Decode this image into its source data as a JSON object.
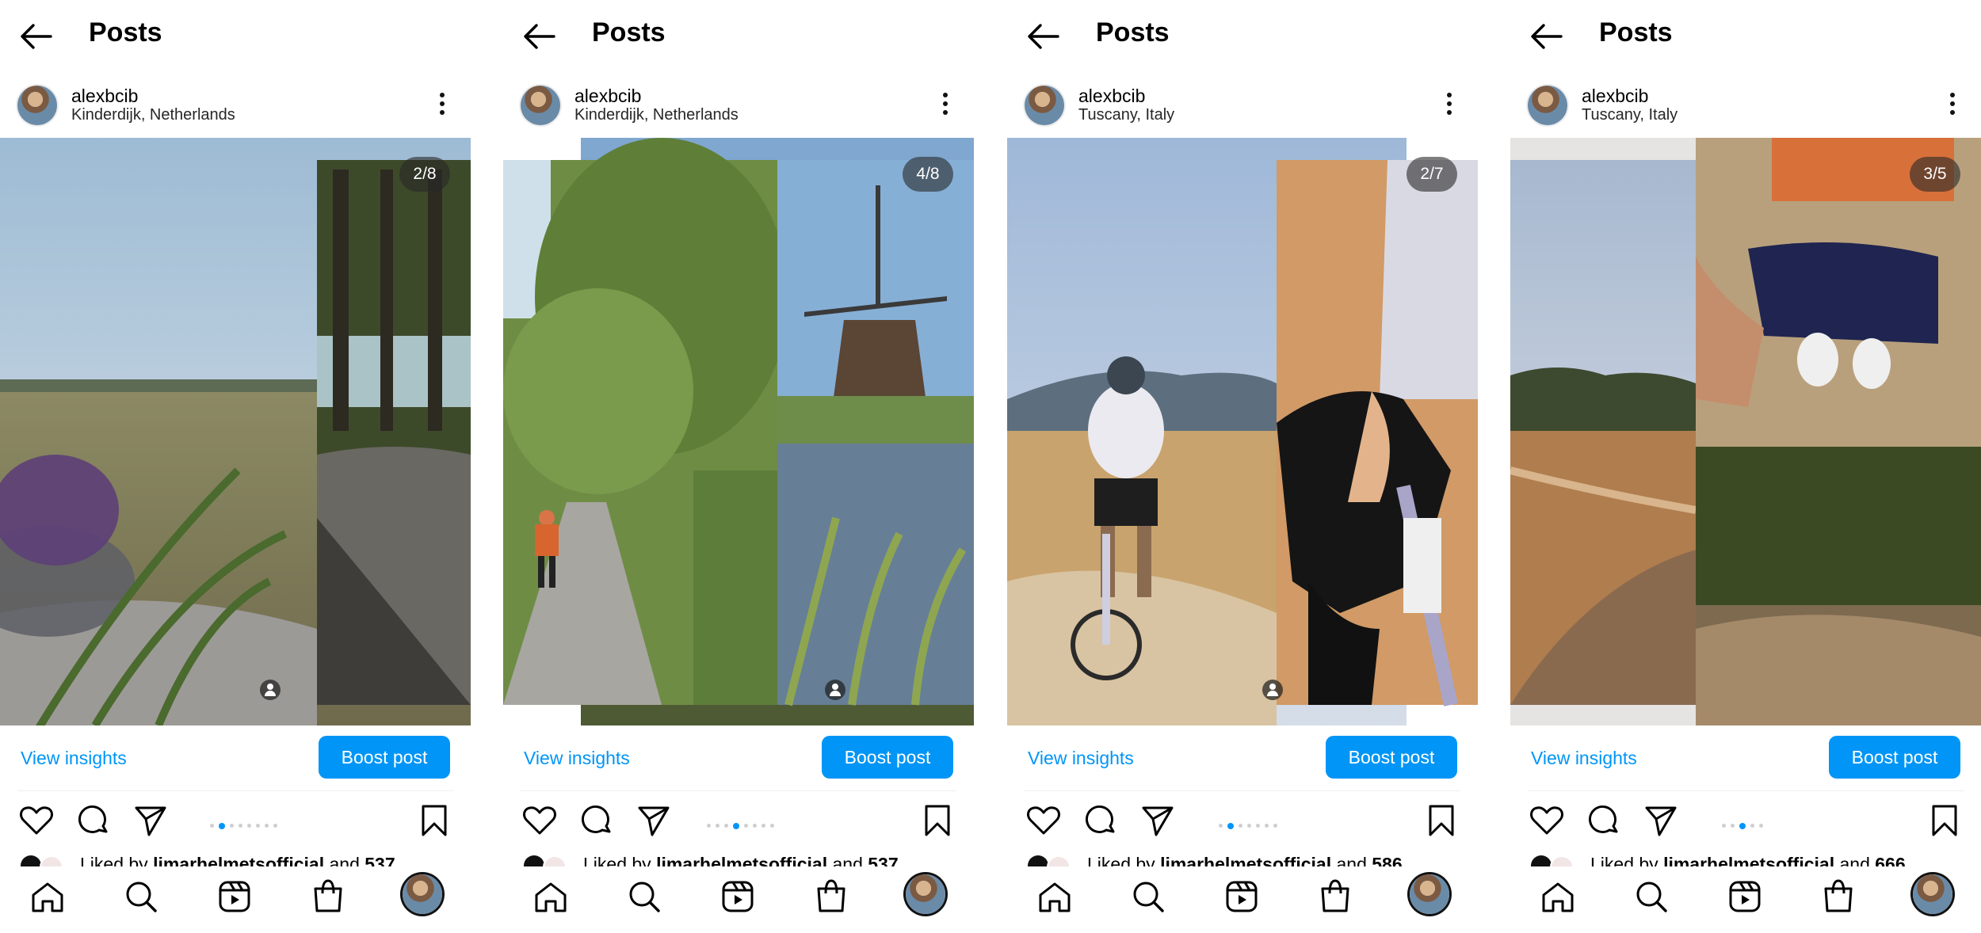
{
  "header_title": "Posts",
  "insights_label": "View insights",
  "boost_label": "Boost post",
  "posts": [
    {
      "username": "alexbcib",
      "location": "Kinderdijk, Netherlands",
      "counter": "2/8",
      "slides": 8,
      "active": 1,
      "liked_prefix": "Liked by ",
      "liked_user": "limarhelmetsofficial",
      "liked_suffix": " and ",
      "liked_count": "537"
    },
    {
      "username": "alexbcib",
      "location": "Kinderdijk, Netherlands",
      "counter": "4/8",
      "slides": 8,
      "active": 3,
      "liked_prefix": "Liked by ",
      "liked_user": "limarhelmetsofficial",
      "liked_suffix": " and ",
      "liked_count": "537"
    },
    {
      "username": "alexbcib",
      "location": "Tuscany, Italy",
      "counter": "2/7",
      "slides": 7,
      "active": 1,
      "liked_prefix": "Liked by ",
      "liked_user": "limarhelmetsofficial",
      "liked_suffix": " and ",
      "liked_count": "586"
    },
    {
      "username": "alexbcib",
      "location": "Tuscany, Italy",
      "counter": "3/5",
      "slides": 5,
      "active": 2,
      "liked_prefix": "Liked by ",
      "liked_user": "limarhelmetsofficial",
      "liked_suffix": " and ",
      "liked_count": "666"
    }
  ],
  "icons": {
    "back": "arrow-left-icon",
    "more": "more-vertical-icon",
    "like": "heart-icon",
    "comment": "comment-icon",
    "share": "paper-plane-icon",
    "save": "bookmark-icon",
    "home": "home-icon",
    "search": "search-icon",
    "reels": "reels-icon",
    "shop": "shopping-bag-icon",
    "profile": "avatar"
  },
  "colors": {
    "accent": "#0095f6",
    "text": "#000000",
    "secondary": "#262626"
  }
}
